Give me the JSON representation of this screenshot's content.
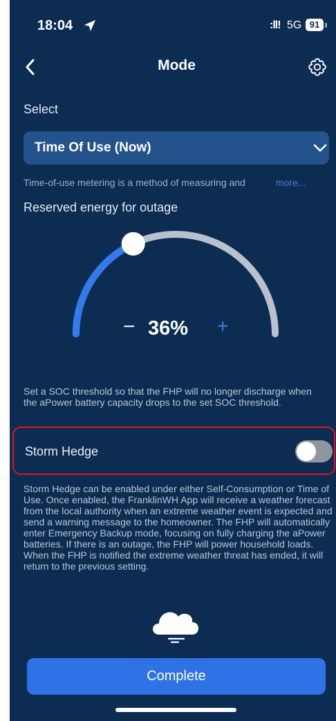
{
  "status_bar": {
    "time": "18:04",
    "signal": ":ll!",
    "network": "5G",
    "battery": "91"
  },
  "header": {
    "title": "Mode"
  },
  "select": {
    "label": "Select",
    "value": "Time Of Use (Now)",
    "description": "Time-of-use metering is a method of measuring and",
    "more_label": "more..."
  },
  "reserve": {
    "label": "Reserved energy for outage",
    "value_text": "36%",
    "value": 0.36,
    "minus": "−",
    "plus": "+",
    "note": "Set a SOC threshold so that the FHP will no longer discharge when the aPower battery capacity drops to the set SOC threshold."
  },
  "storm_hedge": {
    "label": "Storm Hedge",
    "enabled": false,
    "description": "Storm Hedge can be enabled under either Self-Consumption or Time of Use. Once enabled, the FranklinWH App will receive a weather forecast from the local authority when an extreme weather event is expected and send a warning message to the homeowner. The FHP will automatically enter Emergency Backup mode, focusing on fully charging the aPower batteries. If there is an outage, the FHP will power household loads. When the FHP is notified the extreme weather threat has ended, it will return to the previous setting."
  },
  "actions": {
    "complete_label": "Complete"
  },
  "colors": {
    "background": "#0d2c52",
    "accent": "#2f72e6",
    "highlight_border": "#e0141e"
  },
  "icons": [
    "location-arrow-icon",
    "back-chevron-icon",
    "gear-icon",
    "chevron-down-icon",
    "cloud-icon"
  ]
}
